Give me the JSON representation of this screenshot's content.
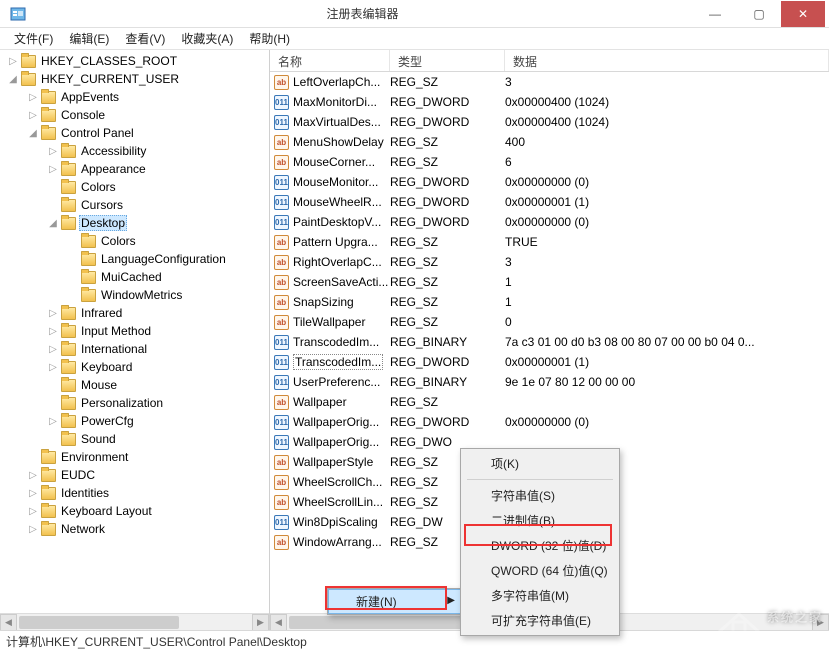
{
  "window": {
    "title": "注册表编辑器"
  },
  "menu": {
    "file": "文件(F)",
    "edit": "编辑(E)",
    "view": "查看(V)",
    "favorites": "收藏夹(A)",
    "help": "帮助(H)"
  },
  "tree": {
    "root_hkcr": "HKEY_CLASSES_ROOT",
    "root_hkcu": "HKEY_CURRENT_USER",
    "hkcu": {
      "appevents": "AppEvents",
      "console": "Console",
      "control_panel": "Control Panel",
      "cp": {
        "accessibility": "Accessibility",
        "appearance": "Appearance",
        "colors": "Colors",
        "cursors": "Cursors",
        "desktop": "Desktop",
        "dk": {
          "colors": "Colors",
          "langconf": "LanguageConfiguration",
          "muicached": "MuiCached",
          "windowmetrics": "WindowMetrics"
        },
        "infrared": "Infrared",
        "input_method": "Input Method",
        "international": "International",
        "keyboard": "Keyboard",
        "mouse": "Mouse",
        "personalization": "Personalization",
        "powercfg": "PowerCfg",
        "sound": "Sound"
      },
      "environment": "Environment",
      "eudc": "EUDC",
      "identities": "Identities",
      "keyboard_layout": "Keyboard Layout",
      "network": "Network"
    }
  },
  "list": {
    "header": {
      "name": "名称",
      "type": "类型",
      "data": "数据"
    },
    "rows": [
      {
        "icon": "sz",
        "name": "LeftOverlapCh...",
        "type": "REG_SZ",
        "data": "3"
      },
      {
        "icon": "bin",
        "name": "MaxMonitorDi...",
        "type": "REG_DWORD",
        "data": "0x00000400 (1024)"
      },
      {
        "icon": "bin",
        "name": "MaxVirtualDes...",
        "type": "REG_DWORD",
        "data": "0x00000400 (1024)"
      },
      {
        "icon": "sz",
        "name": "MenuShowDelay",
        "type": "REG_SZ",
        "data": "400"
      },
      {
        "icon": "sz",
        "name": "MouseCorner...",
        "type": "REG_SZ",
        "data": "6"
      },
      {
        "icon": "bin",
        "name": "MouseMonitor...",
        "type": "REG_DWORD",
        "data": "0x00000000 (0)"
      },
      {
        "icon": "bin",
        "name": "MouseWheelR...",
        "type": "REG_DWORD",
        "data": "0x00000001 (1)"
      },
      {
        "icon": "bin",
        "name": "PaintDesktopV...",
        "type": "REG_DWORD",
        "data": "0x00000000 (0)"
      },
      {
        "icon": "sz",
        "name": "Pattern Upgra...",
        "type": "REG_SZ",
        "data": "TRUE"
      },
      {
        "icon": "sz",
        "name": "RightOverlapC...",
        "type": "REG_SZ",
        "data": "3"
      },
      {
        "icon": "sz",
        "name": "ScreenSaveActi...",
        "type": "REG_SZ",
        "data": "1"
      },
      {
        "icon": "sz",
        "name": "SnapSizing",
        "type": "REG_SZ",
        "data": "1"
      },
      {
        "icon": "sz",
        "name": "TileWallpaper",
        "type": "REG_SZ",
        "data": "0"
      },
      {
        "icon": "bin",
        "name": "TranscodedIm...",
        "type": "REG_BINARY",
        "data": "7a c3 01 00 d0 b3 08 00 80 07 00 00 b0 04 0..."
      },
      {
        "icon": "bin",
        "name": "TranscodedIm...",
        "type": "REG_DWORD",
        "data": "0x00000001 (1)",
        "selected": true
      },
      {
        "icon": "bin",
        "name": "UserPreferenc...",
        "type": "REG_BINARY",
        "data": "9e 1e 07 80 12 00 00 00"
      },
      {
        "icon": "sz",
        "name": "Wallpaper",
        "type": "REG_SZ",
        "data": ""
      },
      {
        "icon": "bin",
        "name": "WallpaperOrig...",
        "type": "REG_DWORD",
        "data": "0x00000000 (0)"
      },
      {
        "icon": "bin",
        "name": "WallpaperOrig...",
        "type": "REG_DWO",
        "data": ""
      },
      {
        "icon": "sz",
        "name": "WallpaperStyle",
        "type": "REG_SZ",
        "data": ""
      },
      {
        "icon": "sz",
        "name": "WheelScrollCh...",
        "type": "REG_SZ",
        "data": ""
      },
      {
        "icon": "sz",
        "name": "WheelScrollLin...",
        "type": "REG_SZ",
        "data": ""
      },
      {
        "icon": "bin",
        "name": "Win8DpiScaling",
        "type": "REG_DW",
        "data": ""
      },
      {
        "icon": "sz",
        "name": "WindowArrang...",
        "type": "REG_SZ",
        "data": ""
      }
    ]
  },
  "context_menu": {
    "new": "新建(N)",
    "sub": {
      "key": "项(K)",
      "string": "字符串值(S)",
      "binary": "二进制值(B)",
      "dword": "DWORD (32 位)值(D)",
      "qword": "QWORD (64 位)值(Q)",
      "multi": "多字符串值(M)",
      "expand": "可扩充字符串值(E)"
    }
  },
  "statusbar": {
    "path": "计算机\\HKEY_CURRENT_USER\\Control Panel\\Desktop"
  },
  "watermark": "系统之家"
}
